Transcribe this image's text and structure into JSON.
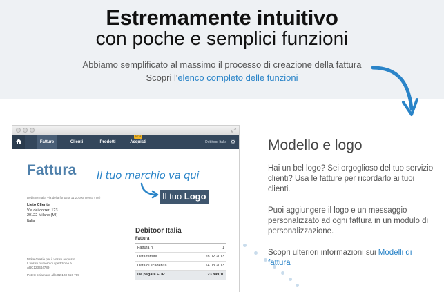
{
  "hero": {
    "title": "Estremamente intuitivo",
    "subtitle": "con poche e semplici funzioni",
    "description": "Abbiamo semplificato al massimo il processo di creazione della fattura",
    "discover_prefix": "Scopri l'",
    "discover_link": "elenco completo delle funzioni"
  },
  "app": {
    "nav": {
      "tabs": [
        "Fatture",
        "Clienti",
        "Prodotti",
        "Acquisti"
      ],
      "badge": "BETA",
      "company": "Debitoor Italia"
    },
    "invoice": {
      "title": "Fattura",
      "brand_note": "Il tuo marchio va qui",
      "logo_prefix": "Il tuo ",
      "logo_bold": "Logo",
      "sender_line": "Debitoor Italia  Via della fontana 11 20100 Trento (TN)",
      "client_name": "Lieto Cliente",
      "client_addr1": "Via dei correri 123",
      "client_addr2": "20122 Milano (MI)",
      "client_country": "Italia",
      "thanks1": "Molte Grazie per il vostro acquisto.",
      "thanks2": "Il vostro numero di spedizione è",
      "thanks3": "ABC123344789",
      "phone": "Potete chiamarci allo 02 123 456 789",
      "summary_company": "Debitoor Italia",
      "summary_section": "Fattura",
      "rows": [
        {
          "label": "Fattura n.",
          "value": "1"
        },
        {
          "label": "Data fattura",
          "value": "28.02.2013"
        },
        {
          "label": "Data di scadenza",
          "value": "14.03.2013"
        },
        {
          "label": "Da pagare EUR",
          "value": "23.849,10"
        }
      ]
    }
  },
  "feature": {
    "title": "Modello e logo",
    "p1": "Hai un bel logo? Sei orgoglioso del tuo servizio clienti? Usa le fatture per ricordarlo ai tuoi clienti.",
    "p2": "Puoi aggiungere il logo e un messaggio personalizzato ad ogni fattura in un modulo di personalizzazione.",
    "p3_prefix": "Scopri ulteriori informazioni sui ",
    "p3_link": "Modelli di fattura"
  },
  "colors": {
    "accent": "#2a84c8",
    "nav": "#34475c",
    "title_blue": "#4f80ab"
  }
}
